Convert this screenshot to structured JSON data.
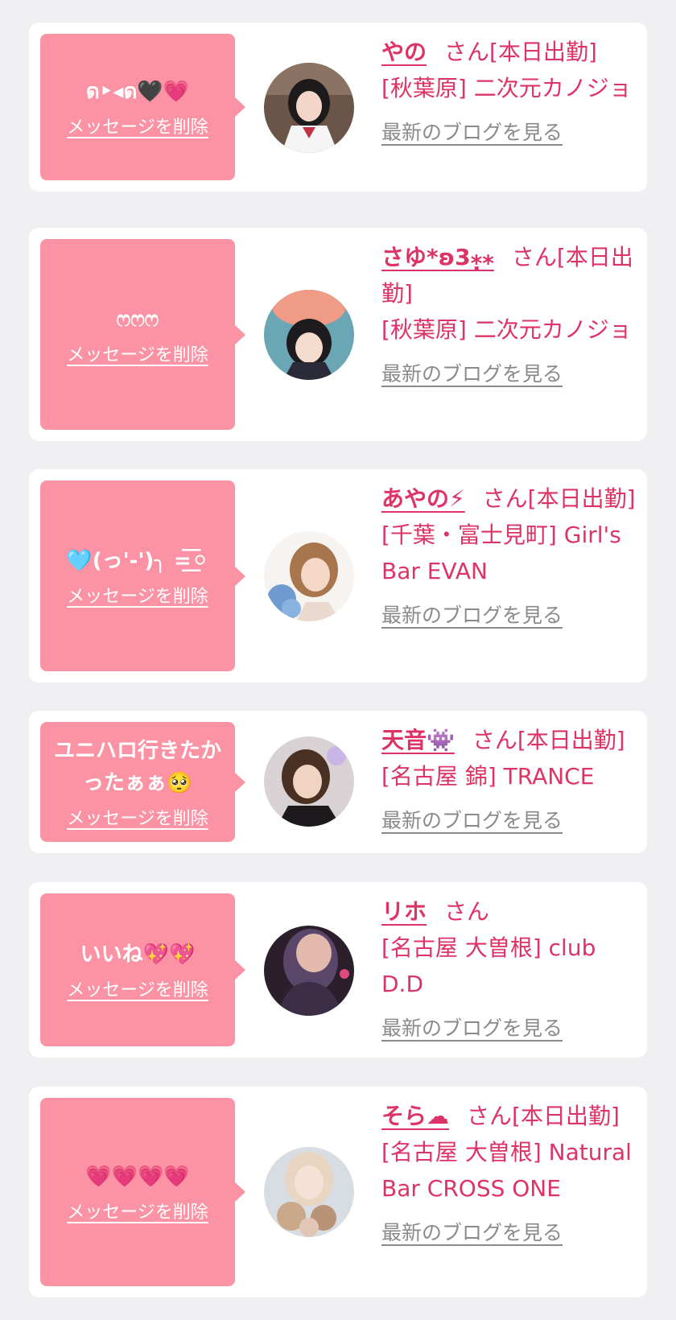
{
  "delete_label": "メッセージを削除",
  "blog_label": "最新のブログを見る",
  "colors": {
    "accent": "#dd3366",
    "bubble": "#fc93a4",
    "background": "#f0f0f2"
  },
  "items": [
    {
      "message": "ด‣◂ด🖤💗",
      "name": "やの",
      "suffix": "さん[本日出勤]",
      "shop": "[秋葉原] 二次元カノジョ"
    },
    {
      "message": "ෆෆෆ",
      "name": "さゆ*ʚ3⁎̣⁎",
      "suffix": "さん[本日出勤]",
      "shop": "[秋葉原] 二次元カノジョ"
    },
    {
      "message": "🩵(っ'-')╮ =͟͟͞͞⚪",
      "name": "あやの⚡",
      "suffix": "さん[本日出勤]",
      "shop": "[千葉・富士見町] Girl's Bar EVAN"
    },
    {
      "message": "ユニハロ行きたかったぁぁ🥺",
      "name": "天音👾",
      "suffix": "さん[本日出勤]",
      "shop": "[名古屋 錦] TRANCE"
    },
    {
      "message": "いいね💖💖",
      "name": "リホ",
      "suffix": "さん",
      "shop": "[名古屋 大曽根] club D.D"
    },
    {
      "message": "💗💗💗💗",
      "name": "そら☁",
      "suffix": "さん[本日出勤]",
      "shop": "[名古屋 大曽根] Natural Bar CROSS ONE"
    }
  ]
}
